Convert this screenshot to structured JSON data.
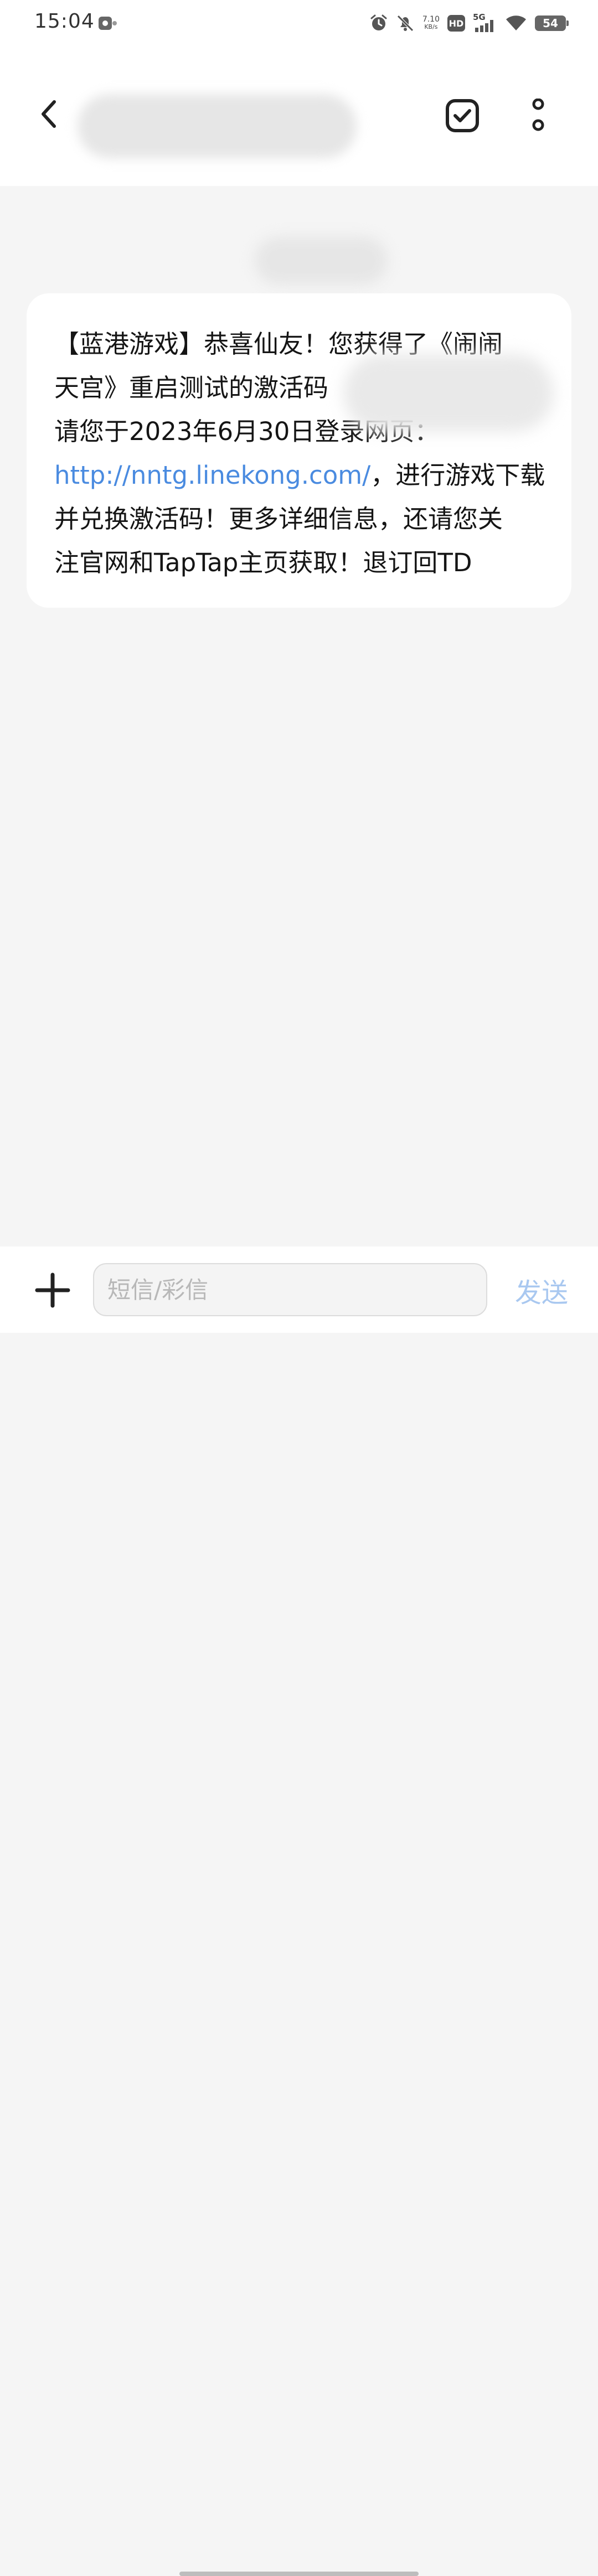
{
  "status_bar": {
    "time": "15:04",
    "net_speed_value": "7.10",
    "net_speed_unit": "KB/s",
    "hd_label": "HD",
    "network_label": "5G",
    "battery_level": "54",
    "icons": [
      "app-notification-icon",
      "alarm-icon",
      "bell-muted-icon",
      "hd-icon",
      "signal-5g-icon",
      "wifi-icon",
      "battery-icon"
    ]
  },
  "header": {
    "contact_name": "",
    "back_icon": "chevron-left-icon",
    "select_icon": "checkbox-icon",
    "more_icon": "more-vertical-icon"
  },
  "conversation": {
    "date_label": "",
    "message": {
      "lines": [
        "【蓝港游戏】恭喜仙友！您获得了《闹闹",
        "天宫》重启测试的激活码",
        "请您于2023年6月30日登录网页：",
        "，进行游戏下载",
        "并兑换激活码！更多详细信息，还请您关",
        "注官网和TapTap主页获取！退订回TD"
      ],
      "link": "http://nntg.linekong.com/"
    }
  },
  "composer": {
    "add_icon": "plus-icon",
    "input_value": "",
    "input_placeholder": "短信/彩信",
    "send_label": "发送"
  },
  "colors": {
    "link": "#4a8be0",
    "send_disabled": "#a9c8f0",
    "background": "#f5f5f5",
    "bubble": "#ffffff"
  }
}
